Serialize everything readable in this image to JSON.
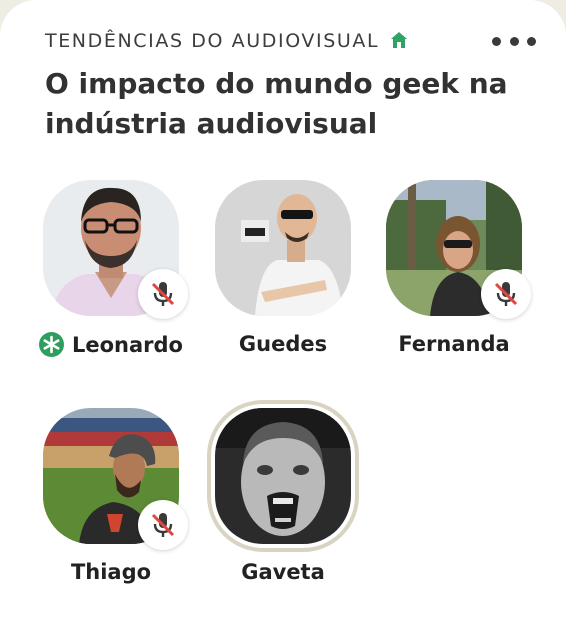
{
  "room": {
    "club_name": "TENDÊNCIAS DO AUDIOVISUAL",
    "club_icon": "home-icon",
    "title": "O impacto do mundo geek na indústria audiovisual",
    "more_icon": "more-dots-icon"
  },
  "speakers": [
    {
      "name": "Leonardo",
      "moderator": true,
      "muted": true
    },
    {
      "name": "Guedes",
      "moderator": false,
      "muted": false
    },
    {
      "name": "Fernanda",
      "moderator": false,
      "muted": true
    },
    {
      "name": "Thiago",
      "moderator": false,
      "muted": true
    },
    {
      "name": "Gaveta",
      "moderator": false,
      "muted": false,
      "speaking": true
    }
  ],
  "colors": {
    "accent_green": "#2e9e5e",
    "mute_red": "#e0463f",
    "speaking_ring": "#d9d4c2"
  }
}
